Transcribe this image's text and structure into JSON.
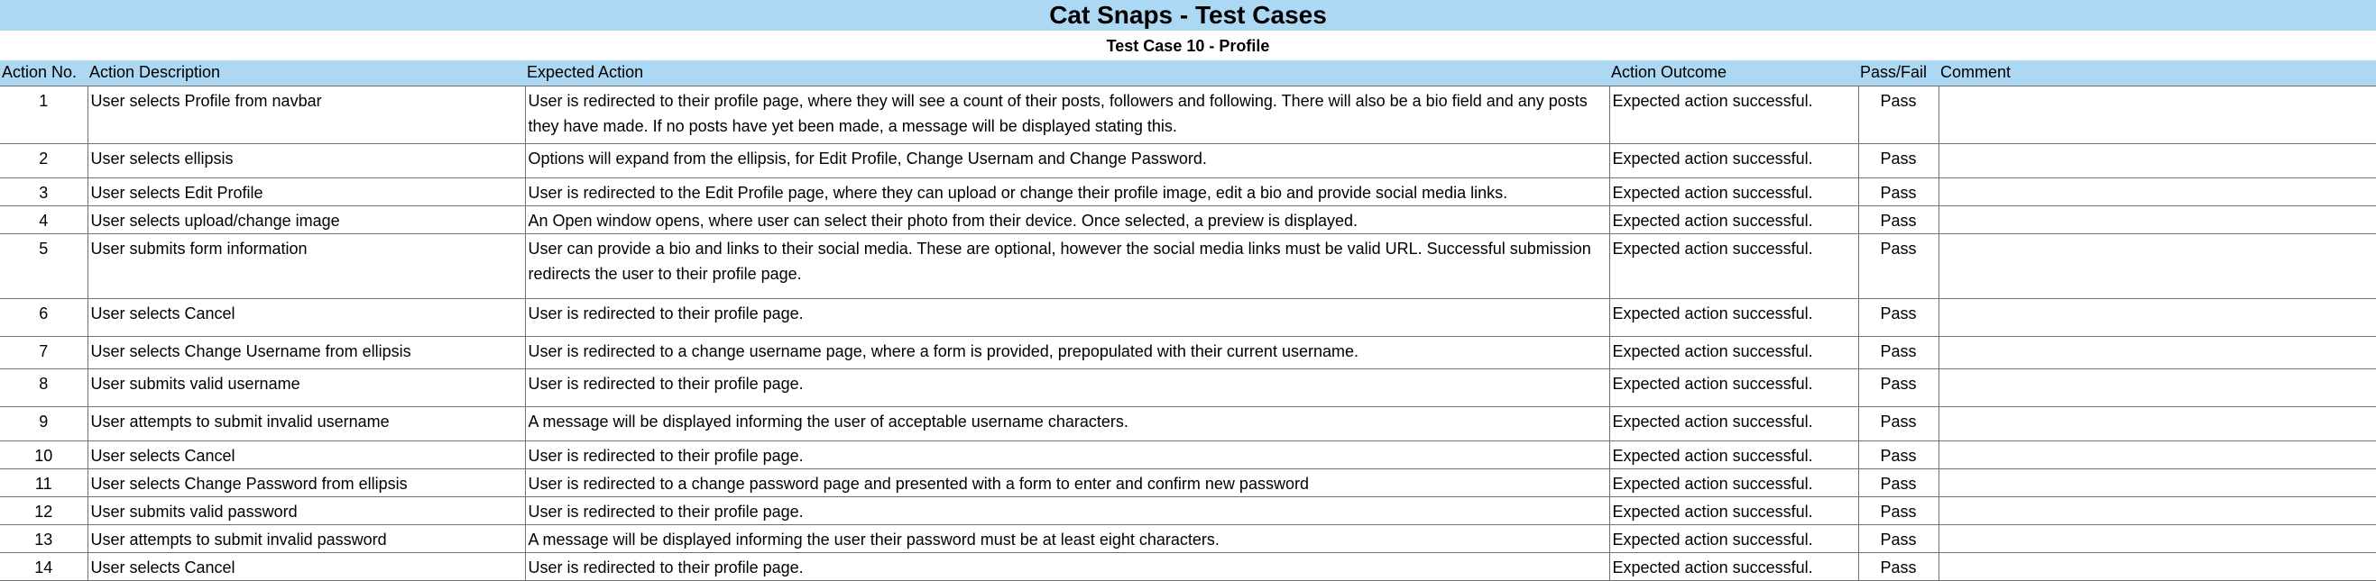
{
  "title": "Cat Snaps - Test Cases",
  "subtitle": "Test Case 10 - Profile",
  "table": {
    "headers": {
      "action_no": "Action No.",
      "description": "Action Description",
      "expected": "Expected Action",
      "outcome": "Action Outcome",
      "pass_fail": "Pass/Fail",
      "comment": "Comment"
    },
    "rows": [
      {
        "no": "1",
        "description": "User selects Profile from navbar",
        "expected": "User is redirected to their profile page, where they will see a count of their posts, followers and following.  There will also be a bio field and any posts they have made.  If no posts have yet been made, a message will be displayed stating this.",
        "outcome": "Expected action successful.",
        "pass_fail": "Pass",
        "comment": ""
      },
      {
        "no": "2",
        "description": "User selects ellipsis",
        "expected": "Options will expand from the ellipsis, for Edit Profile, Change Usernam and Change Password.",
        "outcome": "Expected action successful.",
        "pass_fail": "Pass",
        "comment": ""
      },
      {
        "no": "3",
        "description": "User selects Edit Profile",
        "expected": "User is redirected to the Edit Profile page, where they can upload or change their profile image, edit a bio and provide social media links.",
        "outcome": "Expected action successful.",
        "pass_fail": "Pass",
        "comment": ""
      },
      {
        "no": "4",
        "description": "User selects upload/change image",
        "expected": "An Open window opens, where user can select their photo from their device.  Once selected, a preview is displayed.",
        "outcome": "Expected action successful.",
        "pass_fail": "Pass",
        "comment": ""
      },
      {
        "no": "5",
        "description": "User submits form information",
        "expected": "User can provide a bio and links to their social media.  These are optional, however the social media links must be valid URL.  Successful submission redirects the user to their profile page.",
        "outcome": "Expected action successful.",
        "pass_fail": "Pass",
        "comment": ""
      },
      {
        "no": "6",
        "description": "User selects Cancel",
        "expected": "User is redirected to their profile page.",
        "outcome": "Expected action successful.",
        "pass_fail": "Pass",
        "comment": ""
      },
      {
        "no": "7",
        "description": "User selects Change Username from ellipsis",
        "expected": "User is redirected to a change username page, where a form is provided, prepopulated with their current username.",
        "outcome": "Expected action successful.",
        "pass_fail": "Pass",
        "comment": ""
      },
      {
        "no": "8",
        "description": "User submits valid username",
        "expected": "User is redirected to their profile page.",
        "outcome": "Expected action successful.",
        "pass_fail": "Pass",
        "comment": ""
      },
      {
        "no": "9",
        "description": "User attempts to submit invalid username",
        "expected": "A message will be displayed informing the user of acceptable username characters.",
        "outcome": "Expected action successful.",
        "pass_fail": "Pass",
        "comment": ""
      },
      {
        "no": "10",
        "description": "User selects Cancel",
        "expected": "User is redirected to their profile page.",
        "outcome": "Expected action successful.",
        "pass_fail": "Pass",
        "comment": ""
      },
      {
        "no": "11",
        "description": "User selects Change Password from ellipsis",
        "expected": "User is redirected to a change password page and presented with a form to enter and confirm new password",
        "outcome": "Expected action successful.",
        "pass_fail": "Pass",
        "comment": ""
      },
      {
        "no": "12",
        "description": "User submits valid password",
        "expected": "User is redirected to their profile page.",
        "outcome": "Expected action successful.",
        "pass_fail": "Pass",
        "comment": ""
      },
      {
        "no": "13",
        "description": "User attempts to submit invalid password",
        "expected": "A message will be displayed informing the user their password must be at least eight characters.",
        "outcome": "Expected action successful.",
        "pass_fail": "Pass",
        "comment": ""
      },
      {
        "no": "14",
        "description": "User selects Cancel",
        "expected": "User is redirected to their profile page.",
        "outcome": "Expected action successful.",
        "pass_fail": "Pass",
        "comment": ""
      }
    ]
  }
}
